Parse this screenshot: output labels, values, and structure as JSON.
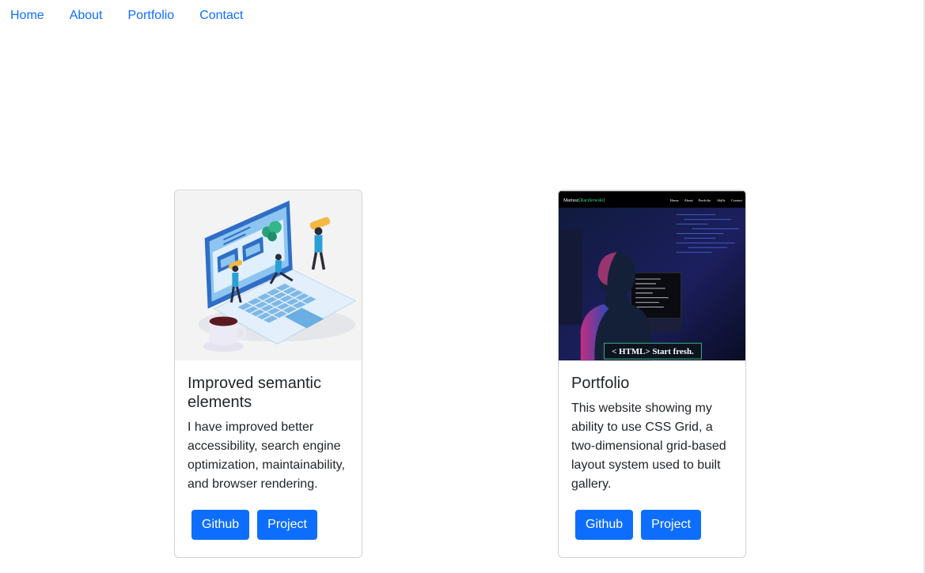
{
  "nav": {
    "items": [
      "Home",
      "About",
      "Portfolio",
      "Contact"
    ]
  },
  "cards": [
    {
      "title": "Improved semantic elements",
      "text": "I have improved better accessibility, search engine optimization, maintainability, and browser rendering.",
      "buttons": [
        "Github",
        "Project"
      ]
    },
    {
      "title": "Portfolio",
      "text": "This website showing my ability to use CSS Grid, a two-dimensional grid-based layout system used to built gallery.",
      "buttons": [
        "Github",
        "Project"
      ],
      "image": {
        "brand": "Mariusz",
        "brand_accent": "[Raczkowski]",
        "menu": [
          "Home",
          "About",
          "Portfolio",
          "Skills",
          "Contact"
        ],
        "banner": "< HTML> Start fresh."
      }
    }
  ],
  "colors": {
    "link": "#0d6efd",
    "button": "#0d6efd"
  }
}
